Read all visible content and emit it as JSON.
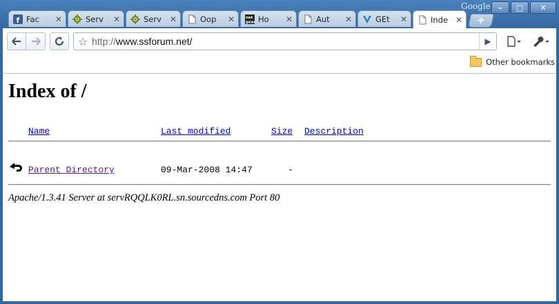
{
  "window": {
    "brand": "Google",
    "controls": {
      "minimize": "–",
      "maximize": "□",
      "close": "✕"
    }
  },
  "tabs": [
    {
      "label": "Fac",
      "icon": "facebook-icon",
      "active": false
    },
    {
      "label": "Serv",
      "icon": "gear-icon",
      "active": false
    },
    {
      "label": "Serv",
      "icon": "gear-icon",
      "active": false
    },
    {
      "label": "Oop",
      "icon": "page-icon",
      "active": false
    },
    {
      "label": "Ho",
      "icon": "netgear-icon",
      "active": false
    },
    {
      "label": "Aut",
      "icon": "page-icon",
      "active": false
    },
    {
      "label": "GEt",
      "icon": "v-logo-icon",
      "active": false
    },
    {
      "label": "Inde",
      "icon": "page-icon",
      "active": true
    }
  ],
  "toolbar": {
    "url_scheme": "http://",
    "url_host": "www.ssforum.net/"
  },
  "bookmarks": {
    "other_label": "Other bookmarks"
  },
  "page": {
    "title": "Index of /",
    "columns": {
      "name": "Name",
      "last_modified": "Last modified",
      "size": "Size",
      "description": "Description"
    },
    "rows": [
      {
        "name": "Parent Directory",
        "modified": "09-Mar-2008 14:47",
        "size": "-",
        "description": ""
      }
    ],
    "footer": "Apache/1.3.41 Server at servRQQLK0RL.sn.sourcedns.com Port 80"
  },
  "colors": {
    "frame": "#3f74ae",
    "link": "#0000cc",
    "visited_link": "#551a8b"
  }
}
